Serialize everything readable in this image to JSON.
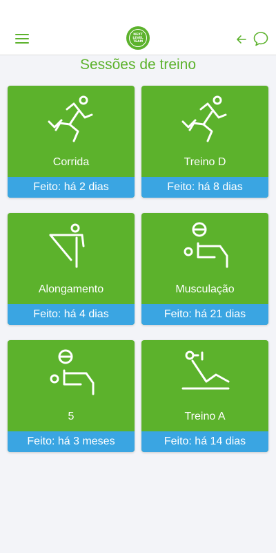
{
  "header": {
    "logo_text": "NEXT LEVEL TEAM",
    "icons": [
      "menu-icon",
      "logo",
      "back-arrow-icon",
      "chat-bubble-icon"
    ]
  },
  "page": {
    "title": "Sessões de treino"
  },
  "cards": [
    {
      "label": "Corrida",
      "status": "Feito: há 2 dias",
      "icon": "running-icon"
    },
    {
      "label": "Treino D",
      "status": "Feito: há 8 dias",
      "icon": "running-icon"
    },
    {
      "label": "Alongamento",
      "status": "Feito: há 4 dias",
      "icon": "stretching-icon"
    },
    {
      "label": "Musculação",
      "status": "Feito: há 21 dias",
      "icon": "weightlifting-icon"
    },
    {
      "label": "5",
      "status": "Feito: há 3 meses",
      "icon": "weightlifting-icon"
    },
    {
      "label": "Treino A",
      "status": "Feito: há 14 dias",
      "icon": "situp-icon"
    }
  ],
  "colors": {
    "brand_green": "#5cb22c",
    "status_blue": "#3aa5e2",
    "background": "#f3f4f8"
  }
}
